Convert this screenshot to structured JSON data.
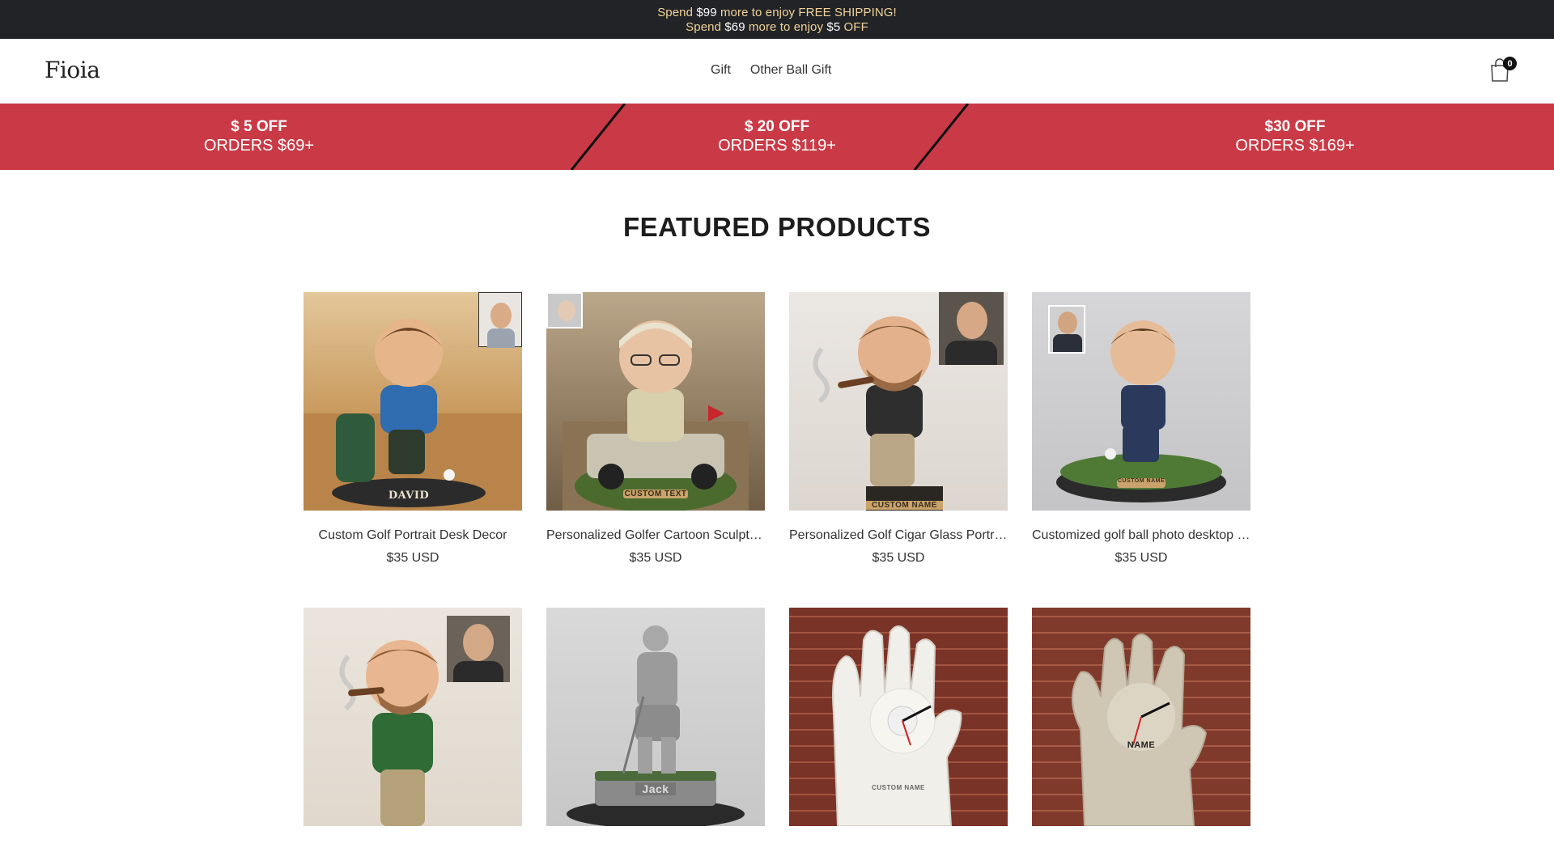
{
  "announcement": {
    "line1": {
      "pre": "Spend ",
      "amount": "$99",
      "post": " more to enjoy FREE SHIPPING!"
    },
    "line2": {
      "pre": "Spend ",
      "amount": "$69",
      "mid": " more to enjoy ",
      "amount2": "$5",
      "post": " OFF"
    }
  },
  "header": {
    "logo": "Fioia",
    "nav": [
      "Gift",
      "Other Ball Gift"
    ],
    "cart_count": "0"
  },
  "promo": [
    {
      "title": "$ 5 OFF",
      "subtitle": "ORDERS $69+"
    },
    {
      "title": "$ 20 OFF",
      "subtitle": "ORDERS $119+"
    },
    {
      "title": "$30 OFF",
      "subtitle": "ORDERS $169+"
    }
  ],
  "featured": {
    "title": "FEATURED PRODUCTS",
    "products": [
      {
        "name": "Custom Golf Portrait Desk Decor",
        "price": "$35 USD",
        "plate": "DAVID"
      },
      {
        "name": "Personalized Golfer Cartoon Sculpture",
        "price": "$35 USD",
        "plate": "CUSTOM TEXT"
      },
      {
        "name": "Personalized Golf Cigar Glass Portrait",
        "price": "$35 USD",
        "plate": "CUSTOM NAME"
      },
      {
        "name": "Customized golf ball photo desktop decor",
        "price": "$35 USD",
        "plate": "CUSTOM NAME"
      },
      {
        "name": "",
        "price": "",
        "plate": ""
      },
      {
        "name": "",
        "price": "",
        "plate": "Jack"
      },
      {
        "name": "",
        "price": "",
        "plate": "CUSTOM NAME"
      },
      {
        "name": "",
        "price": "",
        "plate": "NAME"
      }
    ]
  },
  "colors": {
    "announce_bg": "#222326",
    "announce_text": "#f0d39a",
    "promo_bg": "#c93a46"
  }
}
